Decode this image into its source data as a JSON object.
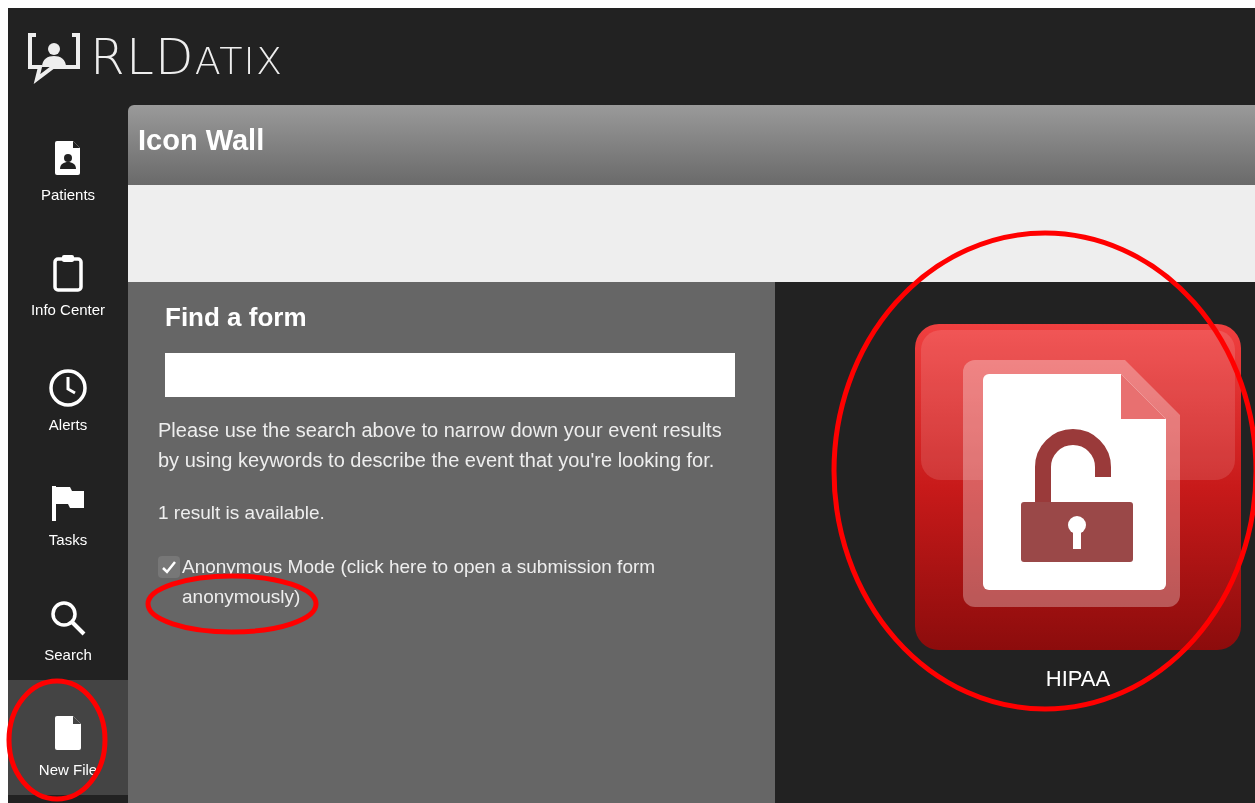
{
  "logo": {
    "prefix": "RLD",
    "suffix": "ATIX"
  },
  "sidebar": {
    "items": [
      {
        "kind": "patient",
        "label": "Patients",
        "selected": false
      },
      {
        "kind": "clipboard",
        "label": "Info Center",
        "selected": false
      },
      {
        "kind": "clock",
        "label": "Alerts",
        "selected": false
      },
      {
        "kind": "flag",
        "label": "Tasks",
        "selected": false
      },
      {
        "kind": "search",
        "label": "Search",
        "selected": false
      },
      {
        "kind": "file",
        "label": "New File",
        "selected": true
      }
    ]
  },
  "panel": {
    "title": "Icon Wall"
  },
  "finder": {
    "heading": "Find a form",
    "help": "Please use the search above to narrow down your event results by using keywords to describe the event that you're looking for.",
    "result_count": "1 result is available.",
    "anonymous": {
      "checked": true,
      "label": "Anonymous Mode (click here to open a submission form anonymously)"
    }
  },
  "forms": [
    {
      "label": "HIPAA"
    }
  ]
}
